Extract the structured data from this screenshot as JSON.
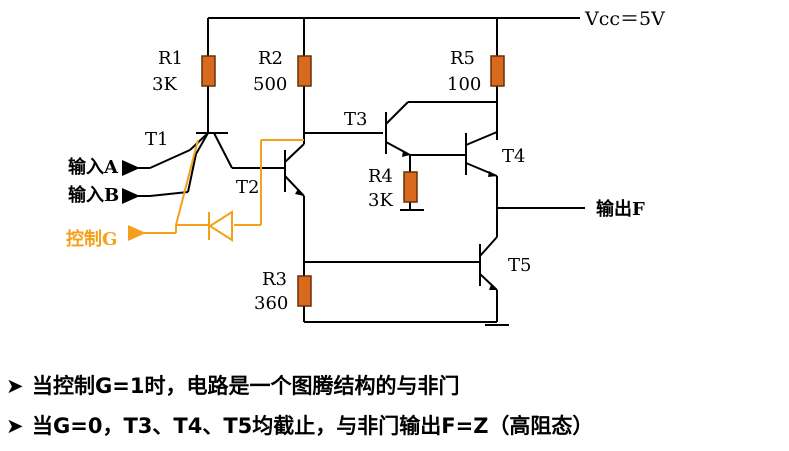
{
  "colors": {
    "wire": "#000000",
    "resistor_fill": "#d86a1e",
    "resistor_stroke": "#6a2e0a",
    "control_path": "#f5a01a"
  },
  "circuit": {
    "vcc_label": "Vcc＝5V",
    "resistors": [
      {
        "name": "R1",
        "value": "3K"
      },
      {
        "name": "R2",
        "value": "500"
      },
      {
        "name": "R5",
        "value": "100"
      },
      {
        "name": "R4",
        "value": "3K"
      },
      {
        "name": "R3",
        "value": "360"
      }
    ],
    "transistors": [
      "T1",
      "T2",
      "T3",
      "T4",
      "T5"
    ],
    "inputs": {
      "a": "输入A",
      "b": "输入B",
      "control": "控制G"
    },
    "output": "输出F"
  },
  "notes": {
    "bullet_icon": "triangle-bullet-icon",
    "bullet_1": "当控制G=1时，电路是一个图腾结构的与非门",
    "bullet_2": "当G=0，T3、T4、T5均截止，与非门输出F=Z（高阻态）"
  }
}
